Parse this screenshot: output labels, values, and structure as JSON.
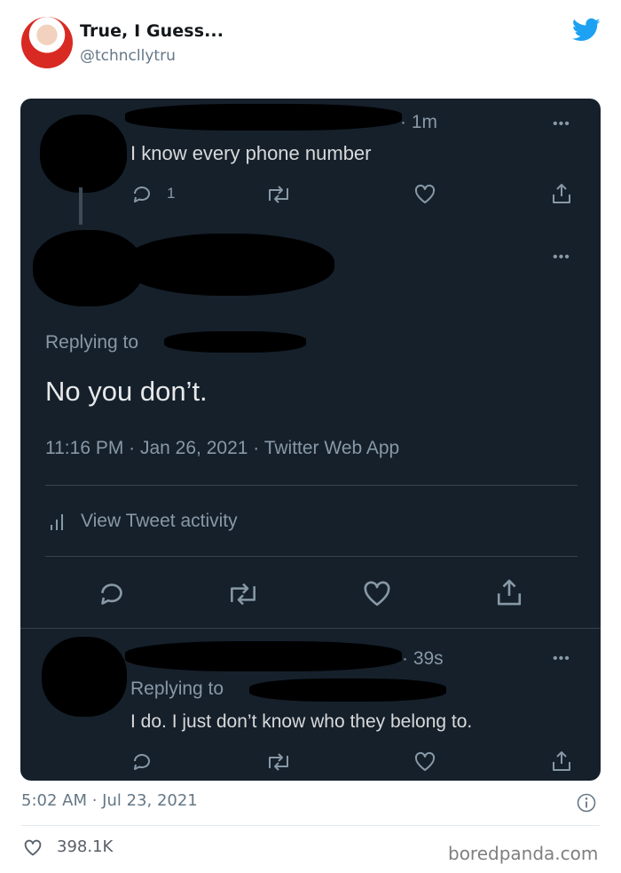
{
  "tweet": {
    "author_name": "True, I Guess...",
    "author_handle": "@tchncllytru",
    "timestamp": "5:02 AM · Jul 23, 2021",
    "like_count": "398.1K"
  },
  "screenshot": {
    "first_reply": {
      "time": "· 1m",
      "text": "I know every phone number",
      "reply_count": "1"
    },
    "main_tweet": {
      "replying_to": "Replying to",
      "text": "No you don’t.",
      "meta": "11:16 PM · Jan 26, 2021 · Twitter Web App",
      "activity_label": "View Tweet activity"
    },
    "second_reply": {
      "time": "· 39s",
      "replying_to": "Replying to",
      "text": "I do. I just don’t know who they belong to."
    },
    "more_label": "•••"
  },
  "watermark": "boredpanda.com",
  "colors": {
    "twitter_blue": "#1da1f2",
    "dark_bg": "#15202b",
    "muted_text": "#8899a6"
  },
  "icons": [
    "twitter-bird-icon",
    "reply-icon",
    "retweet-icon",
    "like-icon",
    "share-icon",
    "more-icon",
    "bar-chart-icon",
    "info-icon",
    "heart-icon"
  ]
}
